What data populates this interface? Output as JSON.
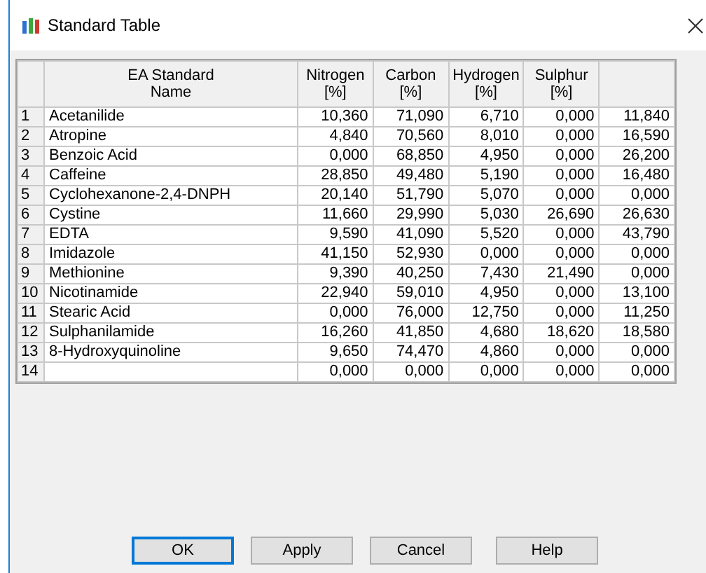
{
  "window": {
    "title": "Standard Table"
  },
  "table": {
    "columns": [
      "EA Standard\nName",
      "Nitrogen\n[%]",
      "Carbon\n[%]",
      "Hydrogen\n[%]",
      "Sulphur\n[%]"
    ],
    "rows": [
      {
        "index": "1",
        "name": "Acetanilide",
        "values": [
          "10,360",
          "71,090",
          "6,710",
          "0,000",
          "11,840"
        ]
      },
      {
        "index": "2",
        "name": "Atropine",
        "values": [
          "4,840",
          "70,560",
          "8,010",
          "0,000",
          "16,590"
        ]
      },
      {
        "index": "3",
        "name": "Benzoic Acid",
        "values": [
          "0,000",
          "68,850",
          "4,950",
          "0,000",
          "26,200"
        ]
      },
      {
        "index": "4",
        "name": "Caffeine",
        "values": [
          "28,850",
          "49,480",
          "5,190",
          "0,000",
          "16,480"
        ]
      },
      {
        "index": "5",
        "name": "Cyclohexanone-2,4-DNPH",
        "values": [
          "20,140",
          "51,790",
          "5,070",
          "0,000",
          "0,000"
        ]
      },
      {
        "index": "6",
        "name": "Cystine",
        "values": [
          "11,660",
          "29,990",
          "5,030",
          "26,690",
          "26,630"
        ]
      },
      {
        "index": "7",
        "name": "EDTA",
        "values": [
          "9,590",
          "41,090",
          "5,520",
          "0,000",
          "43,790"
        ]
      },
      {
        "index": "8",
        "name": "Imidazole",
        "values": [
          "41,150",
          "52,930",
          "0,000",
          "0,000",
          "0,000"
        ]
      },
      {
        "index": "9",
        "name": "Methionine",
        "values": [
          "9,390",
          "40,250",
          "7,430",
          "21,490",
          "0,000"
        ]
      },
      {
        "index": "10",
        "name": "Nicotinamide",
        "values": [
          "22,940",
          "59,010",
          "4,950",
          "0,000",
          "13,100"
        ]
      },
      {
        "index": "11",
        "name": "Stearic Acid",
        "values": [
          "0,000",
          "76,000",
          "12,750",
          "0,000",
          "11,250"
        ]
      },
      {
        "index": "12",
        "name": "Sulphanilamide",
        "values": [
          "16,260",
          "41,850",
          "4,680",
          "18,620",
          "18,580"
        ]
      },
      {
        "index": "13",
        "name": "8-Hydroxyquinoline",
        "values": [
          "9,650",
          "74,470",
          "4,860",
          "0,000",
          "0,000"
        ]
      },
      {
        "index": "14",
        "values": [
          "0,000",
          "0,000",
          "0,000",
          "0,000",
          "0,000"
        ]
      }
    ]
  },
  "buttons": [
    {
      "label": "OK",
      "default": true
    },
    {
      "label": "Apply",
      "default": false
    },
    {
      "label": "Cancel",
      "default": false
    },
    {
      "label": "Help",
      "default": false
    }
  ]
}
